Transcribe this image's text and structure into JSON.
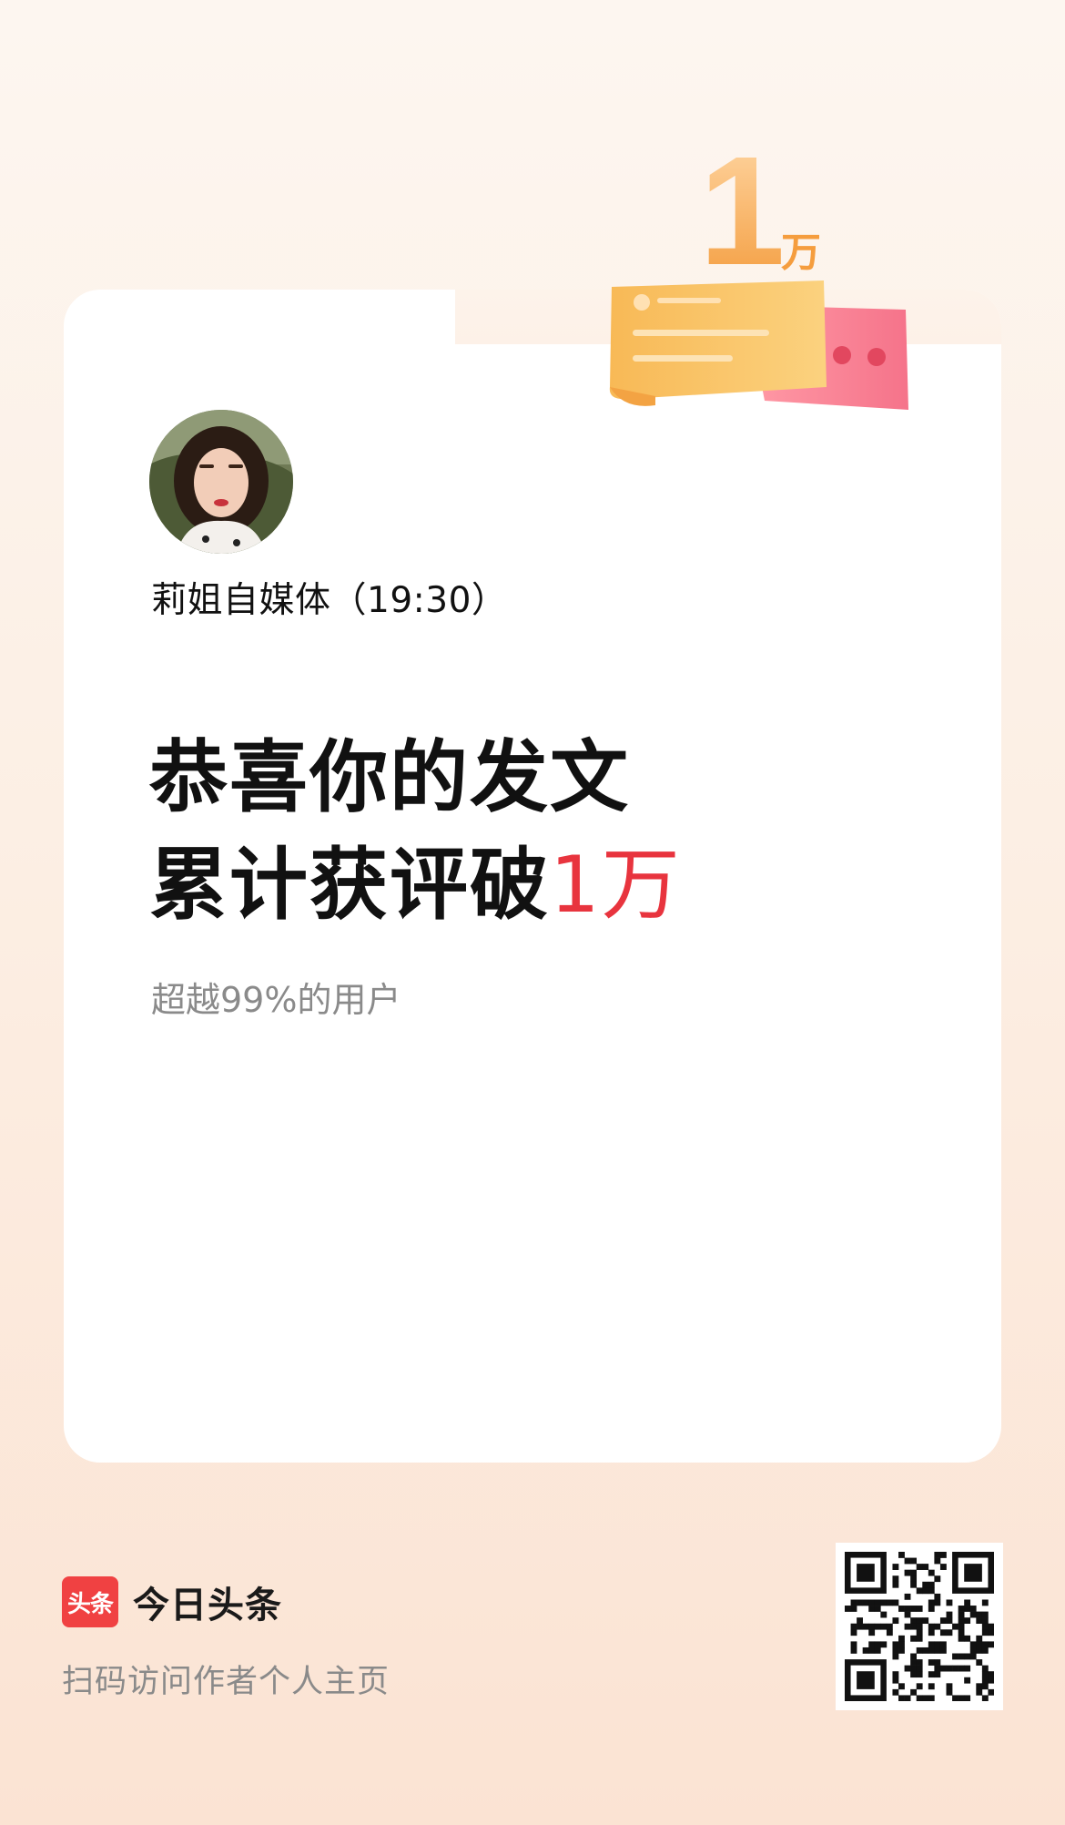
{
  "author": {
    "name": "莉姐自媒体（19:30）"
  },
  "headline": {
    "line1": "恭喜你的发文",
    "line2_prefix": "累计获评破",
    "line2_accent": "1万"
  },
  "subtext": "超越99%的用户",
  "badge": {
    "number": "1",
    "unit": "万"
  },
  "footer": {
    "logo_mark": "头条",
    "app_name": "今日头条",
    "caption": "扫码访问作者个人主页"
  },
  "colors": {
    "accent": "#e8343e",
    "logo_red": "#f04142",
    "badge_orange": "#f7a94b",
    "badge_pink": "#f5738a"
  },
  "icons": [
    "avatar-photo",
    "milestone-badge-icon",
    "toutiao-logo-icon",
    "qr-code"
  ]
}
